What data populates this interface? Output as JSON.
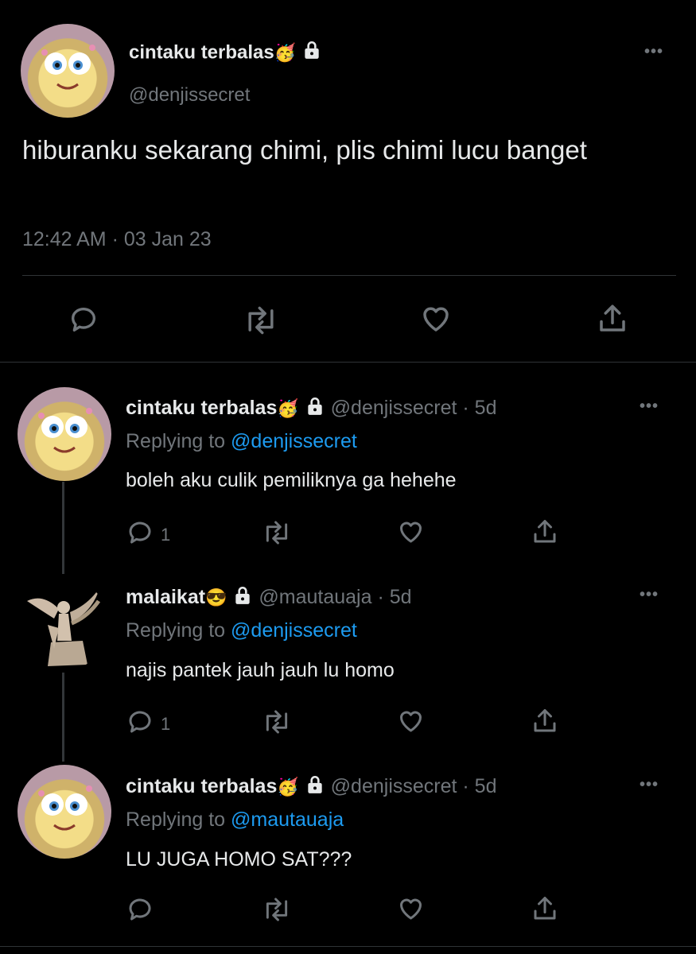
{
  "main_tweet": {
    "display_name": "cintaku terbalas",
    "emoji": "🥳",
    "handle": "@denjissecret",
    "text": "hiburanku sekarang chimi, plis chimi lucu banget",
    "timestamp": "12:42 AM · 03 Jan 23"
  },
  "replies": [
    {
      "display_name": "cintaku terbalas",
      "emoji": "🥳",
      "handle": "@denjissecret",
      "time": "· 5d",
      "replying_label": "Replying to",
      "replying_to": "@denjissecret",
      "text": "boleh aku culik pemiliknya ga hehehe",
      "reply_count": "1"
    },
    {
      "display_name": "malaikat",
      "emoji": "😎",
      "handle": "@mautauaja",
      "time": "· 5d",
      "replying_label": "Replying to",
      "replying_to": "@denjissecret",
      "text": "najis pantek jauh jauh lu homo",
      "reply_count": "1"
    },
    {
      "display_name": "cintaku terbalas",
      "emoji": "🥳",
      "handle": "@denjissecret",
      "time": "· 5d",
      "replying_label": "Replying to",
      "replying_to": "@mautauaja",
      "text": "LU JUGA HOMO SAT???",
      "reply_count": ""
    }
  ],
  "colors": {
    "background": "#000000",
    "text": "#e7e9ea",
    "muted": "#71767b",
    "link": "#1d9bf0",
    "divider": "#2f3336"
  },
  "icons": [
    "reply-icon",
    "retweet-icon",
    "like-icon",
    "share-icon",
    "more-icon",
    "lock-icon"
  ]
}
